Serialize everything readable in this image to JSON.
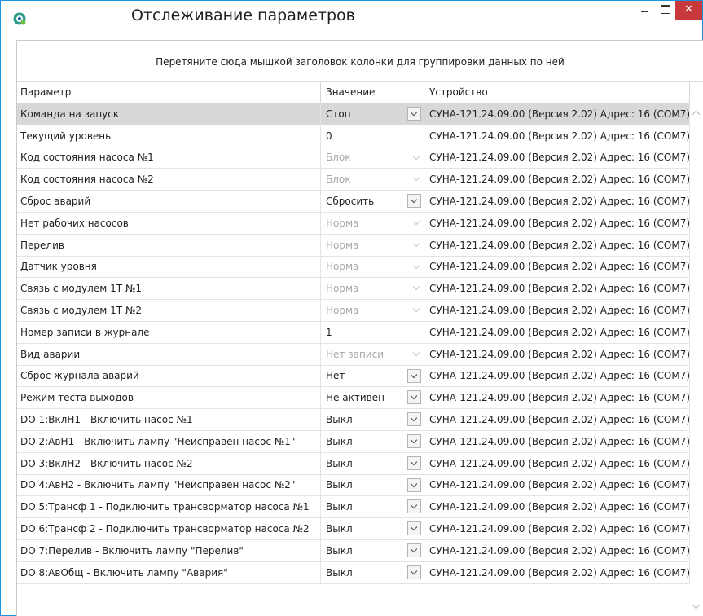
{
  "window": {
    "title": "Отслеживание параметров",
    "close_label": "✕",
    "icon": "gear-icon",
    "accent_color": "#1e8ede",
    "close_color": "#c7393b"
  },
  "group_panel": {
    "hint": "Перетяните сюда мышкой заголовок колонки для группировки данных по ней"
  },
  "columns": [
    "Параметр",
    "Значение",
    "Устройство"
  ],
  "rows": [
    {
      "param": "Команда на запуск",
      "value": "Стоп",
      "state": "dropdown",
      "device": "СУНА-121.24.09.00 (Версия 2.02) Адрес: 16 (COM7)",
      "selected": true
    },
    {
      "param": "Текущий уровень",
      "value": "0",
      "state": "readonly",
      "device": "СУНА-121.24.09.00 (Версия 2.02) Адрес: 16 (COM7)"
    },
    {
      "param": "Код состояния насоса №1",
      "value": "Блок",
      "state": "disabled",
      "device": "СУНА-121.24.09.00 (Версия 2.02) Адрес: 16 (COM7)"
    },
    {
      "param": "Код состояния насоса №2",
      "value": "Блок",
      "state": "disabled",
      "device": "СУНА-121.24.09.00 (Версия 2.02) Адрес: 16 (COM7)"
    },
    {
      "param": "Сброс аварий",
      "value": "Сбросить",
      "state": "dropdown",
      "device": "СУНА-121.24.09.00 (Версия 2.02) Адрес: 16 (COM7)"
    },
    {
      "param": "Нет рабочих насосов",
      "value": "Норма",
      "state": "disabled",
      "device": "СУНА-121.24.09.00 (Версия 2.02) Адрес: 16 (COM7)"
    },
    {
      "param": "Перелив",
      "value": "Норма",
      "state": "disabled",
      "device": "СУНА-121.24.09.00 (Версия 2.02) Адрес: 16 (COM7)"
    },
    {
      "param": "Датчик уровня",
      "value": "Норма",
      "state": "disabled",
      "device": "СУНА-121.24.09.00 (Версия 2.02) Адрес: 16 (COM7)"
    },
    {
      "param": "Связь с модулем 1Т №1",
      "value": "Норма",
      "state": "disabled",
      "device": "СУНА-121.24.09.00 (Версия 2.02) Адрес: 16 (COM7)"
    },
    {
      "param": "Связь с модулем 1Т №2",
      "value": "Норма",
      "state": "disabled",
      "device": "СУНА-121.24.09.00 (Версия 2.02) Адрес: 16 (COM7)"
    },
    {
      "param": "Номер записи в журнале",
      "value": "1",
      "state": "input",
      "device": "СУНА-121.24.09.00 (Версия 2.02) Адрес: 16 (COM7)"
    },
    {
      "param": "Вид аварии",
      "value": "Нет записи",
      "state": "disabled",
      "device": "СУНА-121.24.09.00 (Версия 2.02) Адрес: 16 (COM7)"
    },
    {
      "param": "Сброс журнала аварий",
      "value": "Нет",
      "state": "dropdown",
      "device": "СУНА-121.24.09.00 (Версия 2.02) Адрес: 16 (COM7)"
    },
    {
      "param": "Режим теста выходов",
      "value": "Не активен",
      "state": "dropdown",
      "device": "СУНА-121.24.09.00 (Версия 2.02) Адрес: 16 (COM7)"
    },
    {
      "param": "DO 1:ВклН1 - Включить насос №1",
      "value": "Выкл",
      "state": "dropdown",
      "device": "СУНА-121.24.09.00 (Версия 2.02) Адрес: 16 (COM7)"
    },
    {
      "param": "DO 2:АвН1 - Включить лампу \"Неисправен насос №1\"",
      "value": "Выкл",
      "state": "dropdown",
      "device": "СУНА-121.24.09.00 (Версия 2.02) Адрес: 16 (COM7)"
    },
    {
      "param": "DO 3:ВклН2 - Включить насос №2",
      "value": "Выкл",
      "state": "dropdown",
      "device": "СУНА-121.24.09.00 (Версия 2.02) Адрес: 16 (COM7)"
    },
    {
      "param": "DO 4:АвН2 - Включить лампу \"Неисправен насос №2\"",
      "value": "Выкл",
      "state": "dropdown",
      "device": "СУНА-121.24.09.00 (Версия 2.02) Адрес: 16 (COM7)"
    },
    {
      "param": "DO 5:Трансф 1 - Подключить трансворматор насоса №1",
      "value": "Выкл",
      "state": "dropdown",
      "device": "СУНА-121.24.09.00 (Версия 2.02) Адрес: 16 (COM7)"
    },
    {
      "param": "DO 6:Трансф 2 - Подключить трансворматор насоса №2",
      "value": "Выкл",
      "state": "dropdown",
      "device": "СУНА-121.24.09.00 (Версия 2.02) Адрес: 16 (COM7)"
    },
    {
      "param": "DO 7:Перелив - Включить лампу \"Перелив\"",
      "value": "Выкл",
      "state": "dropdown",
      "device": "СУНА-121.24.09.00 (Версия 2.02) Адрес: 16 (COM7)"
    },
    {
      "param": "DO 8:АвОбщ - Включить лампу \"Авария\"",
      "value": "Выкл",
      "state": "dropdown",
      "device": "СУНА-121.24.09.00 (Версия 2.02) Адрес: 16 (COM7)"
    }
  ]
}
